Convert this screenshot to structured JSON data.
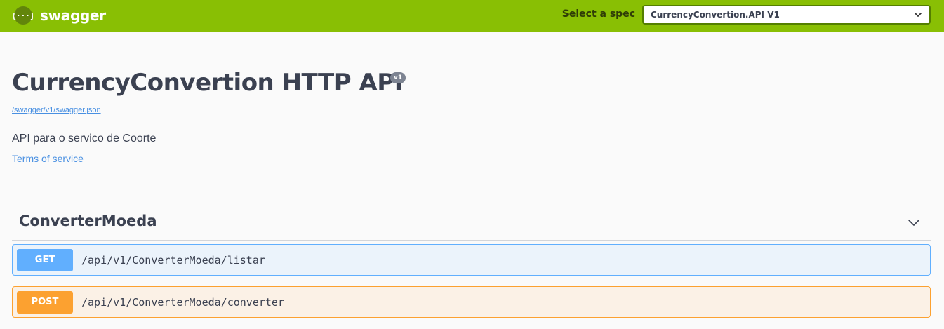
{
  "topbar": {
    "brand": "swagger",
    "spec_label": "Select a spec",
    "spec_selected": "CurrencyConvertion.API V1",
    "color": "#89bf04"
  },
  "info": {
    "title": "CurrencyConvertion HTTP API",
    "version": "v1",
    "spec_url": "/swagger/v1/swagger.json",
    "description": "API para o servico de Coorte",
    "terms_link": "Terms of service"
  },
  "tag": {
    "name": "ConverterMoeda",
    "toggle_icon": "chevron-down-icon"
  },
  "operations": [
    {
      "method": "GET",
      "path": "/api/v1/ConverterMoeda/listar",
      "color": "#61affe"
    },
    {
      "method": "POST",
      "path": "/api/v1/ConverterMoeda/converter",
      "color": "#fca130"
    }
  ]
}
